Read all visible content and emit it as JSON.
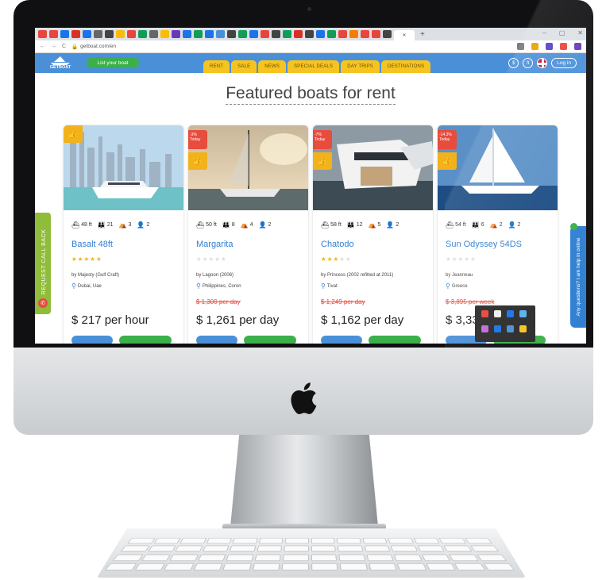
{
  "browser": {
    "url": "getboat.com/en",
    "new_tab": "+",
    "tab_colors": [
      "#e8453c",
      "#e8453c",
      "#1a73e8",
      "#d93025",
      "#1a73e8",
      "#666",
      "#444",
      "#fbbc04",
      "#e8453c",
      "#0f9d58",
      "#666",
      "#fbbc04",
      "#673ab7",
      "#1a73e8",
      "#0f9d58",
      "#1a73e8",
      "#4a90d9",
      "#444",
      "#0f9d58",
      "#1a73e8",
      "#e8453c",
      "#444",
      "#0f9d58",
      "#d93025",
      "#444",
      "#1a73e8",
      "#0f9d58",
      "#e8453c",
      "#f57c00",
      "#e8453c",
      "#e8453c",
      "#444"
    ],
    "extension_colors": [
      "#777",
      "#e8a100",
      "#5a3dc4",
      "#e8453c",
      "#673ab7"
    ],
    "window_controls": [
      "–",
      "▢",
      "✕"
    ]
  },
  "site": {
    "logo_text": "GETBOAT",
    "list_boat": "List your boat",
    "nav_tabs": [
      "RENT",
      "SALE",
      "NEWS",
      "SPECIAL DEALS",
      "DAY TRIPS",
      "DESTINATIONS"
    ],
    "currency": "$",
    "units": "ft",
    "login": "Log in",
    "heading": "Featured boats for rent",
    "callback": "REQUEST CALL BACK",
    "help": "Any questions? I am help in online"
  },
  "colors": {
    "nav_blue": "#4a90d9",
    "accent_yellow": "#f6c421",
    "green": "#3bb04a",
    "discount_red": "#e74c3c",
    "link_blue": "#2f7fd1",
    "star_gold": "#f2b21b",
    "star_empty": "#ddd"
  },
  "cards": [
    {
      "name": "Basalt 48ft",
      "length": "48 ft",
      "guests": "21",
      "cabins": "3",
      "crew": "2",
      "rating": 5,
      "builder": "by Majesty (Gulf Craft)",
      "location": "Dubai, Uae",
      "old_price": "",
      "price": "$ 217 per hour",
      "discount": "",
      "discount_sub": ""
    },
    {
      "name": "Margarita",
      "length": "50 ft",
      "guests": "8",
      "cabins": "4",
      "crew": "2",
      "rating": 0,
      "builder": "by Lagoon (2006)",
      "location": "Philippines, Coron",
      "old_price": "$ 1,300 per day",
      "price": "$ 1,261 per day",
      "discount": "-3%",
      "discount_sub": "Today"
    },
    {
      "name": "Chatodo",
      "length": "58 ft",
      "guests": "12",
      "cabins": "5",
      "crew": "2",
      "rating": 3,
      "builder": "by Princess (2002 refitted at 2011)",
      "location": "Tivat",
      "old_price": "$ 1,249 per day",
      "price": "$ 1,162 per day",
      "discount": "-7%",
      "discount_sub": "Today"
    },
    {
      "name": "Sun Odyssey 54DS",
      "length": "54 ft",
      "guests": "6",
      "cabins": "2",
      "crew": "2",
      "rating": 0,
      "builder": "by Jeanneau",
      "location": "Greece",
      "old_price": "$ 3,895 per week",
      "price": "$ 3,33",
      "discount": "-14.3%",
      "discount_sub": "Today"
    }
  ],
  "tray_colors": [
    "#e8453c",
    "#eee",
    "#1a73e8",
    "#5ab1f0",
    "#c06bd8",
    "#1a73e8",
    "#4a90d9",
    "#f6c421"
  ]
}
